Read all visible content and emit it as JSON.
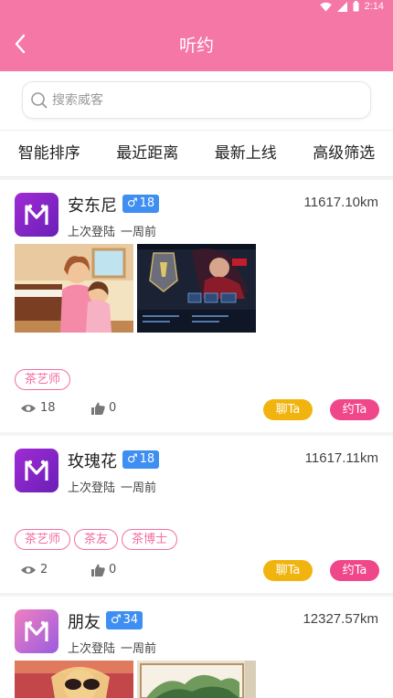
{
  "status_bar": {
    "time": "2:14"
  },
  "header": {
    "title": "听约"
  },
  "search": {
    "placeholder": "搜索威客"
  },
  "tabs": [
    "智能排序",
    "最近距离",
    "最新上线",
    "高级筛选"
  ],
  "users": [
    {
      "name": "安东尼",
      "gender_symbol": "♂",
      "age": "18",
      "distance": "11617.10km",
      "last_login_label": "上次登陆",
      "last_login": "一周前",
      "tags": [
        "茶艺师"
      ],
      "views": "18",
      "likes": "0",
      "chat_label": "聊Ta",
      "date_label": "约Ta"
    },
    {
      "name": "玫瑰花",
      "gender_symbol": "♂",
      "age": "18",
      "distance": "11617.11km",
      "last_login_label": "上次登陆",
      "last_login": "一周前",
      "tags": [
        "茶艺师",
        "茶友",
        "茶博士"
      ],
      "views": "2",
      "likes": "0",
      "chat_label": "聊Ta",
      "date_label": "约Ta"
    },
    {
      "name": "朋友",
      "gender_symbol": "♂",
      "age": "34",
      "distance": "12327.57km",
      "last_login_label": "上次登陆",
      "last_login": "一周前"
    }
  ],
  "colors": {
    "header": "#f577a6",
    "tag": "#f26ea0",
    "chat": "#f1b40f",
    "date": "#f0478a",
    "badge": "#3f8ef2"
  }
}
